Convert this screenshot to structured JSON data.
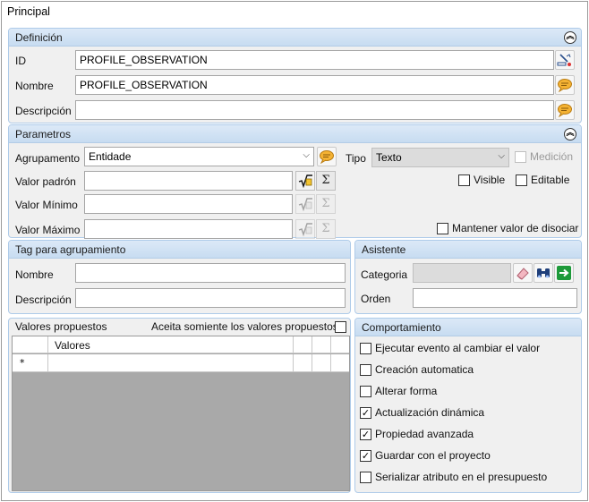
{
  "window": {
    "title": "Principal"
  },
  "definicion": {
    "title": "Definición",
    "id_label": "ID",
    "id_value": "PROFILE_OBSERVATION",
    "nombre_label": "Nombre",
    "nombre_value": "PROFILE_OBSERVATION",
    "descripcion_label": "Descripción",
    "descripcion_value": ""
  },
  "parametros": {
    "title": "Parametros",
    "agrupamento_label": "Agrupamento",
    "agrupamento_value": "Entidade",
    "tipo_label": "Tipo",
    "tipo_value": "Texto",
    "medicion_label": "Medición",
    "medicion_checked": false,
    "visible_label": "Visible",
    "visible_checked": false,
    "editable_label": "Editable",
    "editable_checked": false,
    "valor_padron_label": "Valor padrón",
    "valor_minimo_label": "Valor Mínimo",
    "valor_maximo_label": "Valor Máximo",
    "mantener_label": "Mantener valor de disociar",
    "mantener_checked": false,
    "sigma": "Σ"
  },
  "tag": {
    "title": "Tag para agrupamiento",
    "nombre_label": "Nombre",
    "descripcion_label": "Descripción"
  },
  "asistente": {
    "title": "Asistente",
    "categoria_label": "Categoria",
    "orden_label": "Orden"
  },
  "valores": {
    "title": "Valores propuestos",
    "aceita_label": "Aceita somiente los valores propuestos",
    "aceita_checked": false,
    "column_header": "Valores",
    "new_row_marker": "*"
  },
  "comportamiento": {
    "title": "Comportamiento",
    "items": [
      {
        "label": "Ejecutar evento al cambiar el valor",
        "checked": false
      },
      {
        "label": "Creación automatica",
        "checked": false
      },
      {
        "label": "Alterar forma",
        "checked": false
      },
      {
        "label": "Actualización dinámica",
        "checked": true
      },
      {
        "label": "Propiedad avanzada",
        "checked": true
      },
      {
        "label": "Guardar con el proyecto",
        "checked": true
      },
      {
        "label": "Serializar atributo en el presupuesto",
        "checked": false
      }
    ]
  },
  "icons": {
    "collapse": "double-chevron-up-icon",
    "id_edit": "edit-id-icon",
    "translate": "speech-bubble-icon",
    "formula": "square-root-icon",
    "sum": "sigma-icon",
    "erase": "eraser-icon",
    "search": "binoculars-icon",
    "go": "green-arrow-icon"
  },
  "colors": {
    "panel_header": "#c7dcf1",
    "panel_border": "#aecbe9",
    "panel_bg": "#f0f0f0",
    "grid_bg": "#a9a9a9",
    "speech_bubble": "#f4b233",
    "go_button": "#1e9a3a"
  }
}
